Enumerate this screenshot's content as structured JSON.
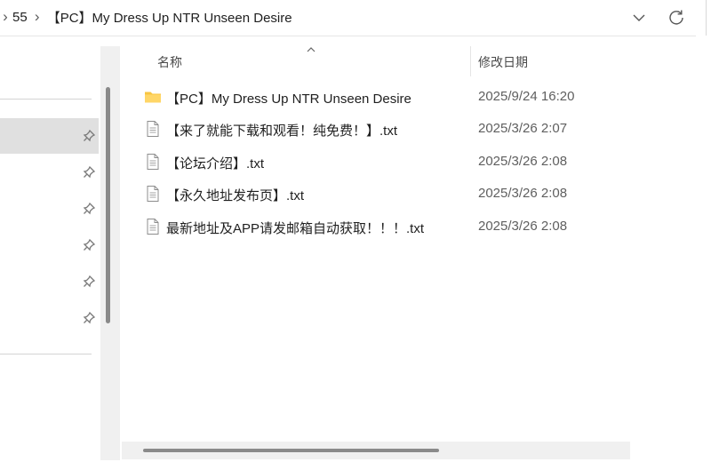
{
  "address_bar": {
    "crumbs": [
      "55",
      "【PC】My Dress Up NTR Unseen Desire"
    ],
    "separator": "›",
    "icons": {
      "dropdown": "chevron-down-icon",
      "refresh": "refresh-icon"
    }
  },
  "nav_pane": {
    "pinned_items": 6,
    "pin_icon": "pin-icon"
  },
  "file_list": {
    "columns": {
      "name": "名称",
      "date_modified": "修改日期"
    },
    "sort": "name-ascending",
    "rows": [
      {
        "icon": "folder-icon",
        "name": "【PC】My Dress Up NTR Unseen Desire",
        "date": "2025/9/24 16:20"
      },
      {
        "icon": "text-file-icon",
        "name": "【来了就能下载和观看！纯免费！】.txt",
        "date": "2025/3/26 2:07"
      },
      {
        "icon": "text-file-icon",
        "name": "【论坛介绍】.txt",
        "date": "2025/3/26 2:08"
      },
      {
        "icon": "text-file-icon",
        "name": "【永久地址发布页】.txt",
        "date": "2025/3/26 2:08"
      },
      {
        "icon": "text-file-icon",
        "name": "最新地址及APP请发邮箱自动获取！！！.txt",
        "date": "2025/3/26 2:08"
      }
    ]
  },
  "colors": {
    "folder": "#F8C542",
    "selected_nav": "#E0E0E0",
    "scroll_thumb": "#8A8A8A"
  }
}
